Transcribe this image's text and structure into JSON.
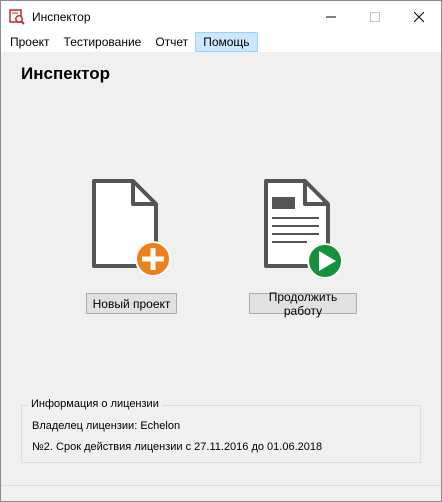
{
  "window": {
    "title": "Инспектор"
  },
  "menu": {
    "items": [
      "Проект",
      "Тестирование",
      "Отчет",
      "Помощь"
    ]
  },
  "main": {
    "heading": "Инспектор",
    "new_project_label": "Новый проект",
    "continue_label": "Продолжить работу"
  },
  "license": {
    "legend": "Информация о лицензии",
    "owner": "Владелец лицензии: Echelon",
    "term": "№2. Срок действия лицензии с 27.11.2016 до 01.06.2018"
  },
  "colors": {
    "add_accent": "#ef7f1a",
    "play_accent": "#14913a",
    "app_icon": "#c8262d",
    "menu_highlight": "#cce8ff"
  },
  "icons": {
    "app": "inspector-app-icon",
    "new_project": "new-document-plus-icon",
    "continue": "document-play-icon"
  }
}
